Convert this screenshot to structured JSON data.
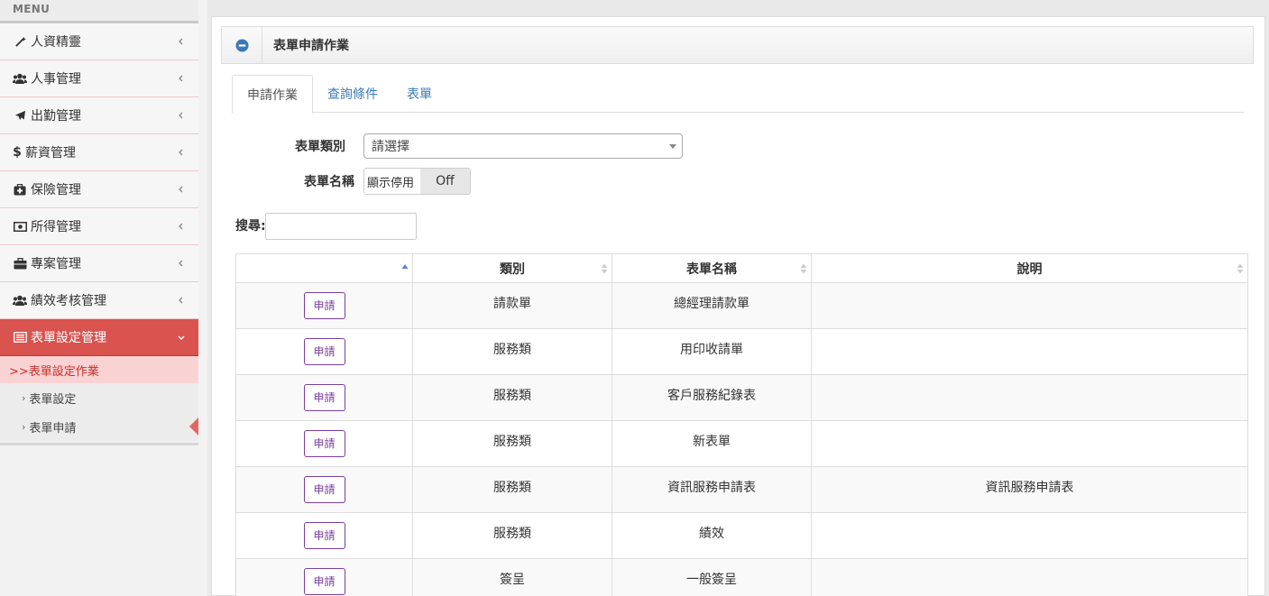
{
  "sidebar": {
    "menu_header": "MENU",
    "items": [
      {
        "label": "人資精靈",
        "icon": "magic-wand-icon"
      },
      {
        "label": "人事管理",
        "icon": "users-icon"
      },
      {
        "label": "出勤管理",
        "icon": "plane-icon"
      },
      {
        "label": "薪資管理",
        "icon": "dollar-icon"
      },
      {
        "label": "保險管理",
        "icon": "medkit-icon"
      },
      {
        "label": "所得管理",
        "icon": "money-icon"
      },
      {
        "label": "專案管理",
        "icon": "briefcase-icon"
      },
      {
        "label": "績效考核管理",
        "icon": "users-icon"
      },
      {
        "label": "表單設定管理",
        "icon": "list-alt-icon",
        "active": true
      }
    ],
    "submenu_title": ">>表單設定作業",
    "sub_items": [
      {
        "label": "表單設定"
      },
      {
        "label": "表單申請"
      }
    ]
  },
  "panel": {
    "title": "表單申請作業"
  },
  "tabs": [
    {
      "label": "申請作業"
    },
    {
      "label": "查詢條件"
    },
    {
      "label": "表單"
    }
  ],
  "form": {
    "category_label": "表單類別",
    "category_value": "請選擇",
    "name_label": "表單名稱",
    "toggle_on": "顯示停用",
    "toggle_off": "Off"
  },
  "search": {
    "label": "搜尋:",
    "value": ""
  },
  "table": {
    "headers": [
      "",
      "類別",
      "表單名稱",
      "說明"
    ],
    "button_label": "申請",
    "rows": [
      {
        "category": "請款單",
        "name": "總經理請款單",
        "description": ""
      },
      {
        "category": "服務類",
        "name": "用印收請單",
        "description": ""
      },
      {
        "category": "服務類",
        "name": "客戶服務紀錄表",
        "description": ""
      },
      {
        "category": "服務類",
        "name": "新表單",
        "description": ""
      },
      {
        "category": "服務類",
        "name": "資訊服務申請表",
        "description": "資訊服務申請表"
      },
      {
        "category": "服務類",
        "name": "績效",
        "description": ""
      },
      {
        "category": "簽呈",
        "name": "一般簽呈",
        "description": ""
      }
    ]
  },
  "colors": {
    "active_menu": "#d9534f",
    "submenu_bg": "#f9d3d3",
    "link_blue": "#3a7ab7",
    "apply_button": "#7b3f9e"
  }
}
